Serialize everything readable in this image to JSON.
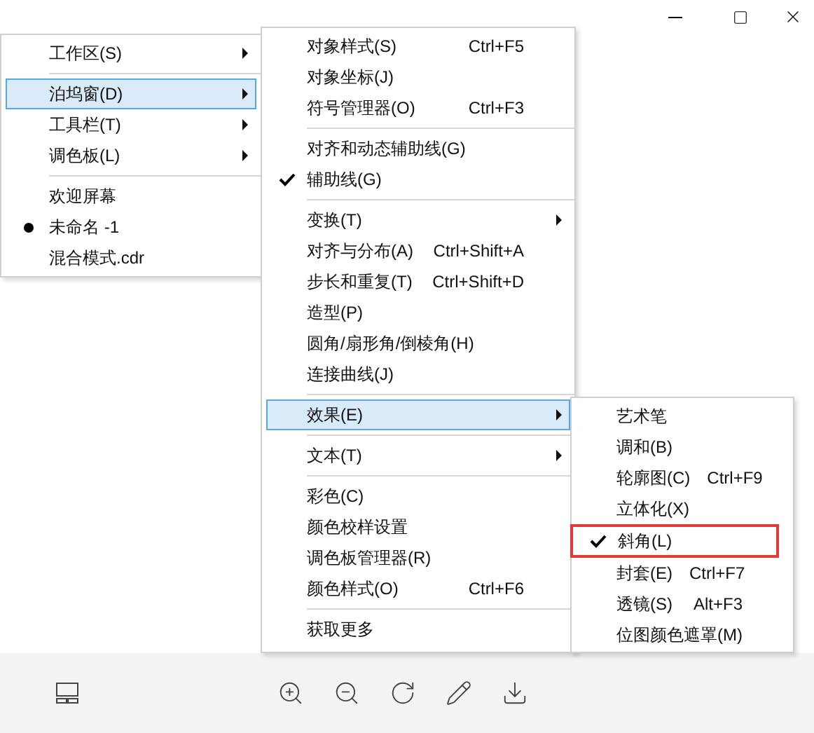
{
  "menus": [
    {
      "items": [
        {
          "kind": "item",
          "label": "工作区(S)",
          "submenu": true,
          "selected": false,
          "radio": false
        },
        {
          "kind": "separator"
        },
        {
          "kind": "item",
          "label": "泊坞窗(D)",
          "submenu": true,
          "selected": true,
          "radio": false
        },
        {
          "kind": "item",
          "label": "工具栏(T)",
          "submenu": true,
          "selected": false,
          "radio": false
        },
        {
          "kind": "item",
          "label": "调色板(L)",
          "submenu": true,
          "selected": false,
          "radio": false
        },
        {
          "kind": "separator"
        },
        {
          "kind": "item",
          "label": "欢迎屏幕",
          "submenu": false,
          "selected": false,
          "radio": false
        },
        {
          "kind": "item",
          "label": "未命名 -1",
          "submenu": false,
          "selected": false,
          "radio": true
        },
        {
          "kind": "item",
          "label": "混合模式.cdr",
          "submenu": false,
          "selected": false,
          "radio": false
        }
      ]
    },
    {
      "items": [
        {
          "kind": "item",
          "label": "对象样式(S)",
          "shortcut": "Ctrl+F5",
          "submenu": false,
          "selected": false,
          "checked": false
        },
        {
          "kind": "item",
          "label": "对象坐标(J)",
          "submenu": false,
          "selected": false,
          "checked": false
        },
        {
          "kind": "item",
          "label": "符号管理器(O)",
          "shortcut": "Ctrl+F3",
          "submenu": false,
          "selected": false,
          "checked": false
        },
        {
          "kind": "separator"
        },
        {
          "kind": "item",
          "label": "对齐和动态辅助线(G)",
          "submenu": false,
          "selected": false,
          "checked": false
        },
        {
          "kind": "item",
          "label": "辅助线(G)",
          "submenu": false,
          "selected": false,
          "checked": true
        },
        {
          "kind": "separator"
        },
        {
          "kind": "item",
          "label": "变换(T)",
          "submenu": true,
          "selected": false,
          "checked": false
        },
        {
          "kind": "item",
          "label": "对齐与分布(A)",
          "shortcut": "Ctrl+Shift+A",
          "submenu": false,
          "selected": false,
          "checked": false
        },
        {
          "kind": "item",
          "label": "步长和重复(T)",
          "shortcut": "Ctrl+Shift+D",
          "submenu": false,
          "selected": false,
          "checked": false
        },
        {
          "kind": "item",
          "label": "造型(P)",
          "submenu": false,
          "selected": false,
          "checked": false
        },
        {
          "kind": "item",
          "label": "圆角/扇形角/倒棱角(H)",
          "submenu": false,
          "selected": false,
          "checked": false
        },
        {
          "kind": "item",
          "label": "连接曲线(J)",
          "submenu": false,
          "selected": false,
          "checked": false
        },
        {
          "kind": "separator"
        },
        {
          "kind": "item",
          "label": "效果(E)",
          "submenu": true,
          "selected": true,
          "checked": false
        },
        {
          "kind": "separator"
        },
        {
          "kind": "item",
          "label": "文本(T)",
          "submenu": true,
          "selected": false,
          "checked": false
        },
        {
          "kind": "separator"
        },
        {
          "kind": "item",
          "label": "彩色(C)",
          "submenu": false,
          "selected": false,
          "checked": false
        },
        {
          "kind": "item",
          "label": "颜色校样设置",
          "submenu": false,
          "selected": false,
          "checked": false
        },
        {
          "kind": "item",
          "label": "调色板管理器(R)",
          "submenu": false,
          "selected": false,
          "checked": false
        },
        {
          "kind": "item",
          "label": "颜色样式(O)",
          "shortcut": "Ctrl+F6",
          "submenu": false,
          "selected": false,
          "checked": false
        },
        {
          "kind": "separator"
        },
        {
          "kind": "item",
          "label": "获取更多",
          "submenu": false,
          "selected": false,
          "checked": false
        }
      ]
    },
    {
      "items": [
        {
          "kind": "item",
          "label": "艺术笔",
          "selected": false,
          "checked": false,
          "highlighted": false
        },
        {
          "kind": "item",
          "label": "调和(B)",
          "selected": false,
          "checked": false,
          "highlighted": false
        },
        {
          "kind": "item",
          "label": "轮廓图(C)",
          "shortcut": "Ctrl+F9",
          "selected": false,
          "checked": false,
          "highlighted": false
        },
        {
          "kind": "item",
          "label": "立体化(X)",
          "selected": false,
          "checked": false,
          "highlighted": false
        },
        {
          "kind": "item",
          "label": "斜角(L)",
          "selected": false,
          "checked": true,
          "highlighted": true
        },
        {
          "kind": "item",
          "label": "封套(E)",
          "shortcut": "Ctrl+F7",
          "selected": false,
          "checked": false,
          "highlighted": false
        },
        {
          "kind": "item",
          "label": "透镜(S)",
          "shortcut": "Alt+F3",
          "selected": false,
          "checked": false,
          "highlighted": false
        },
        {
          "kind": "item",
          "label": "位图颜色遮罩(M)",
          "selected": false,
          "checked": false,
          "highlighted": false
        }
      ]
    }
  ]
}
